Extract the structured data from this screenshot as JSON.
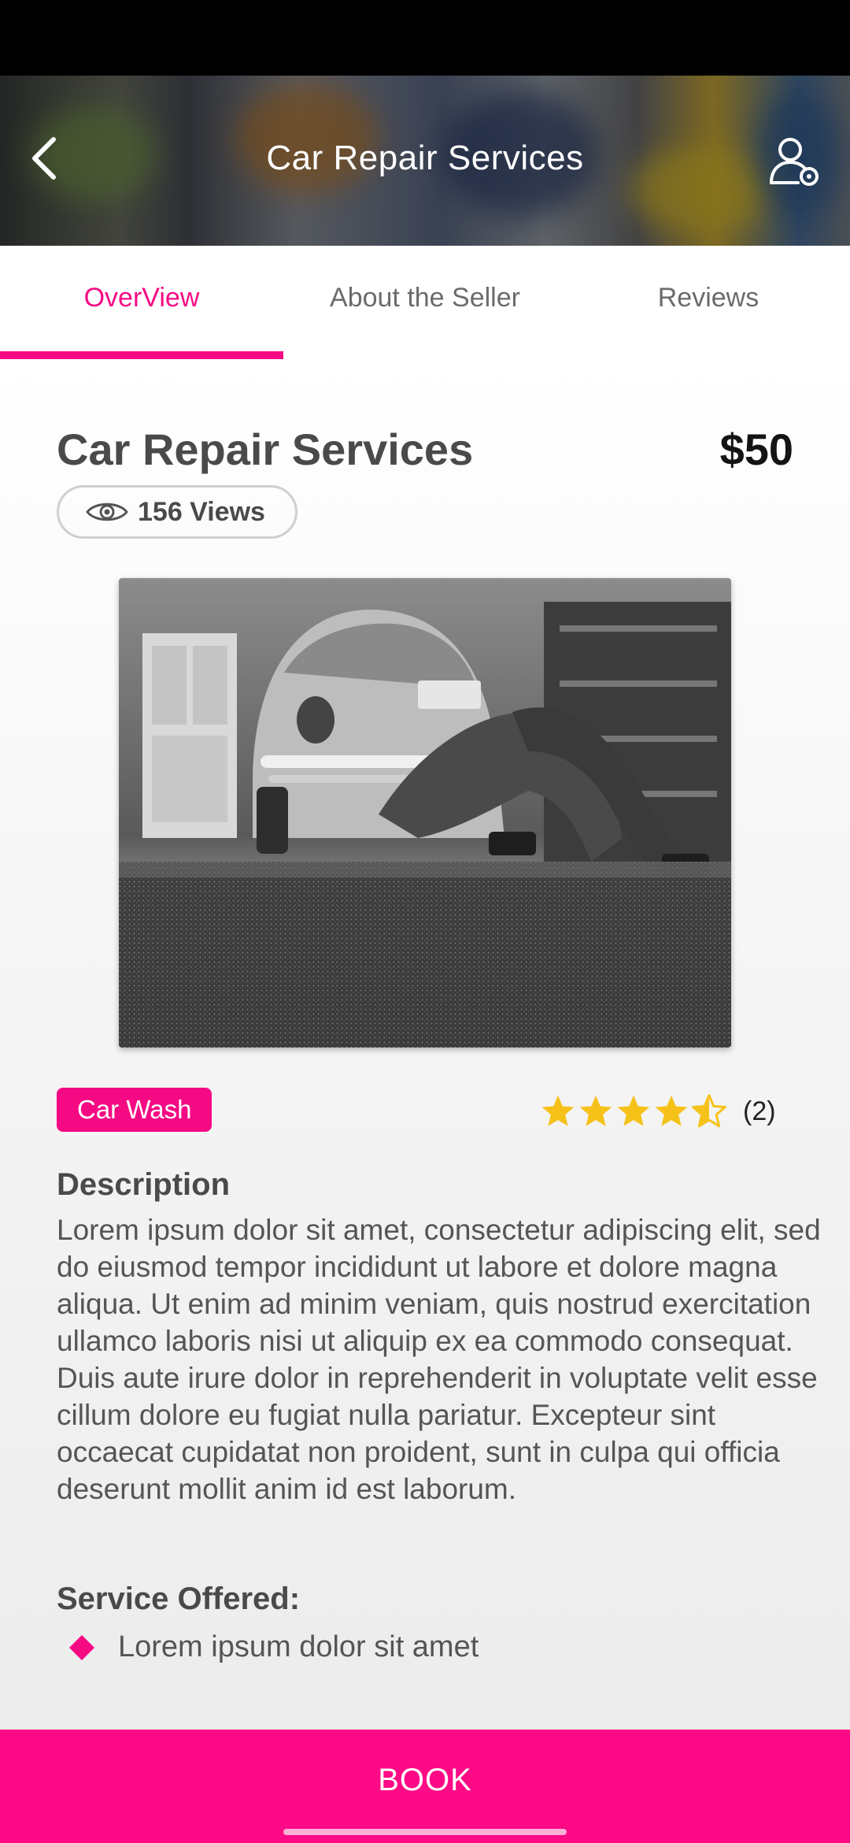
{
  "header": {
    "title": "Car Repair Services"
  },
  "tabs": [
    {
      "label": "OverView",
      "active": true
    },
    {
      "label": "About the Seller",
      "active": false
    },
    {
      "label": "Reviews",
      "active": false
    }
  ],
  "service": {
    "title": "Car Repair Services",
    "price": "$50",
    "views": "156 Views",
    "category": "Car Wash",
    "rating": 4.5,
    "rating_count": "(2)"
  },
  "description": {
    "heading": "Description",
    "text": "Lorem ipsum dolor sit amet, consectetur adipiscing elit, sed do eiusmod tempor incididunt ut labore et dolore magna aliqua. Ut enim ad minim veniam, quis nostrud exercitation ullamco laboris nisi ut aliquip ex ea commodo consequat. Duis aute irure dolor in reprehenderit in voluptate velit esse cillum dolore eu fugiat nulla pariatur. Excepteur sint occaecat cupidatat non proident, sunt in culpa qui officia deserunt mollit anim id est laborum."
  },
  "services_offered": {
    "heading": "Service Offered:",
    "items": [
      "Lorem ipsum dolor sit amet"
    ]
  },
  "book": {
    "label": "BOOK"
  },
  "colors": {
    "accent": "#f50a84",
    "star": "#f6c21a"
  },
  "icons": {
    "back": "chevron-left-icon",
    "profile": "user-settings-icon",
    "views": "eye-icon",
    "rating": "star-icon",
    "bullet": "diamond-icon"
  }
}
